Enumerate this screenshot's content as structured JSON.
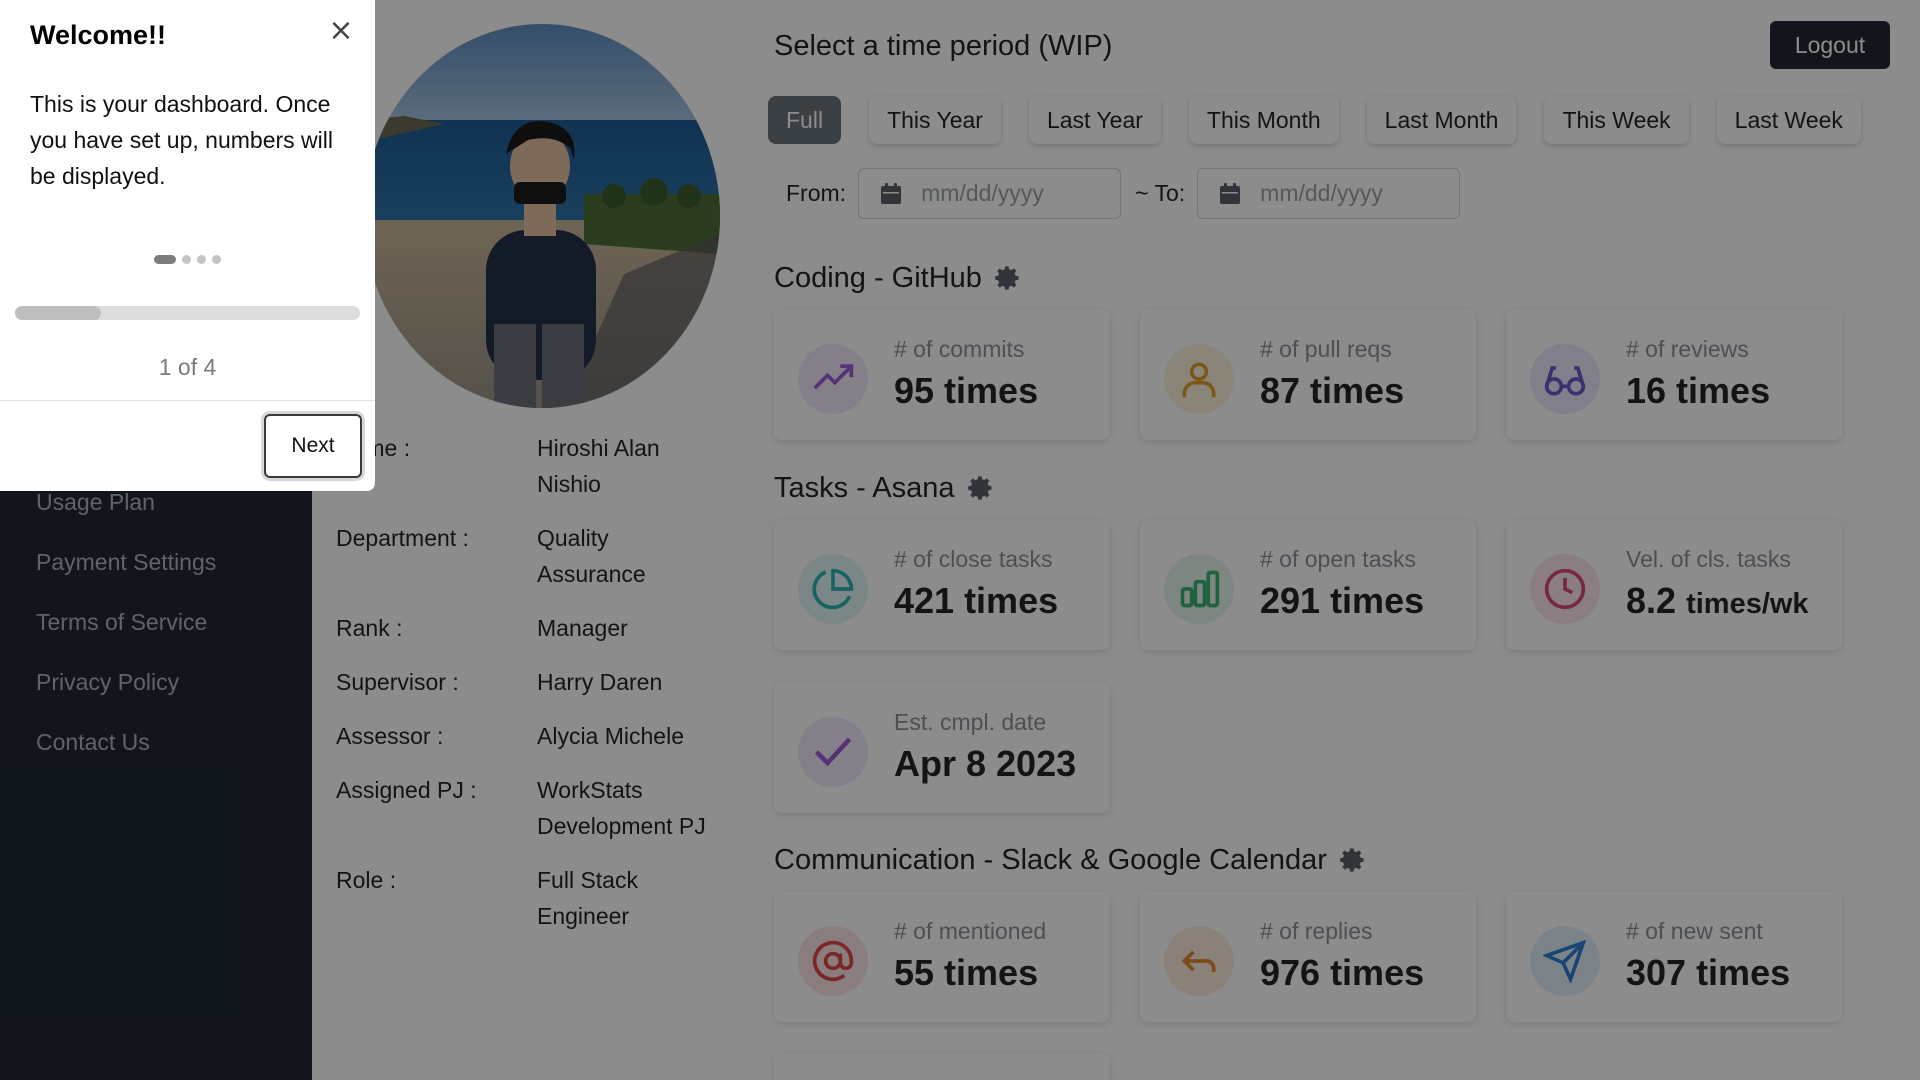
{
  "sidebar": {
    "items": [
      {
        "label": "Usage Plan",
        "icon": ""
      },
      {
        "label": "Payment Settings"
      },
      {
        "label": "Terms of Service"
      },
      {
        "label": "Privacy Policy"
      },
      {
        "label": "Contact Us"
      }
    ]
  },
  "profile": {
    "fields": [
      {
        "label": "Name :",
        "value": "Hiroshi Alan Nishio"
      },
      {
        "label": "Department :",
        "value": "Quality Assurance"
      },
      {
        "label": "Rank :",
        "value": "Manager"
      },
      {
        "label": "Supervisor :",
        "value": "Harry Daren"
      },
      {
        "label": "Assessor :",
        "value": "Alycia Michele"
      },
      {
        "label": "Assigned PJ :",
        "value": "WorkStats Development PJ"
      },
      {
        "label": "Role :",
        "value": "Full Stack Engineer"
      }
    ]
  },
  "header": {
    "period_title": "Select a time period (WIP)",
    "logout_label": "Logout"
  },
  "periods": {
    "buttons": [
      "Full",
      "This Year",
      "Last Year",
      "This Month",
      "Last Month",
      "This Week",
      "Last Week"
    ],
    "selected": "Full"
  },
  "date_range": {
    "from_label": "From:",
    "to_label": "~ To:",
    "from_placeholder": "mm/dd/yyyy",
    "to_placeholder": "mm/dd/yyyy"
  },
  "sections": {
    "github": {
      "title": "Coding - GitHub",
      "cards": [
        {
          "label": "# of commits",
          "value": "95 times",
          "icon": "trending-up-icon",
          "color": "#9b59d6"
        },
        {
          "label": "# of pull reqs",
          "value": "87 times",
          "icon": "user-icon",
          "color": "#e0a030"
        },
        {
          "label": "# of reviews",
          "value": "16 times",
          "icon": "glasses-icon",
          "color": "#6a5acd"
        }
      ]
    },
    "asana": {
      "title": "Tasks - Asana",
      "cards": [
        {
          "label": "# of close tasks",
          "value": "421 times",
          "icon": "pie-chart-icon",
          "color": "#2bb3b3"
        },
        {
          "label": "# of open tasks",
          "value": "291 times",
          "icon": "bar-chart-icon",
          "color": "#3cb371"
        },
        {
          "label": "Vel. of cls. tasks",
          "value": "8.2",
          "unit": "times/wk",
          "icon": "clock-icon",
          "color": "#d9477a"
        },
        {
          "label": "Est. cmpl. date",
          "value": "Apr 8 2023",
          "icon": "check-icon",
          "color": "#9b59d6"
        }
      ]
    },
    "comm": {
      "title": "Communication - Slack & Google Calendar",
      "cards": [
        {
          "label": "# of mentioned",
          "value": "55 times",
          "icon": "at-sign-icon",
          "color": "#e04848"
        },
        {
          "label": "# of replies",
          "value": "976 times",
          "icon": "reply-icon",
          "color": "#e08a30"
        },
        {
          "label": "# of new sent",
          "value": "307 times",
          "icon": "send-icon",
          "color": "#2f7fd0"
        }
      ]
    }
  },
  "tour": {
    "title": "Welcome!!",
    "close_glyph": "×",
    "body": "This is your dashboard. Once you have set up, numbers will be displayed.",
    "step_count": "1 of 4",
    "next_label": "Next",
    "progress": 0.25
  },
  "colors": {
    "sidebar_bg": "#212934",
    "overlay": "rgba(0,0,0,0.45)"
  }
}
